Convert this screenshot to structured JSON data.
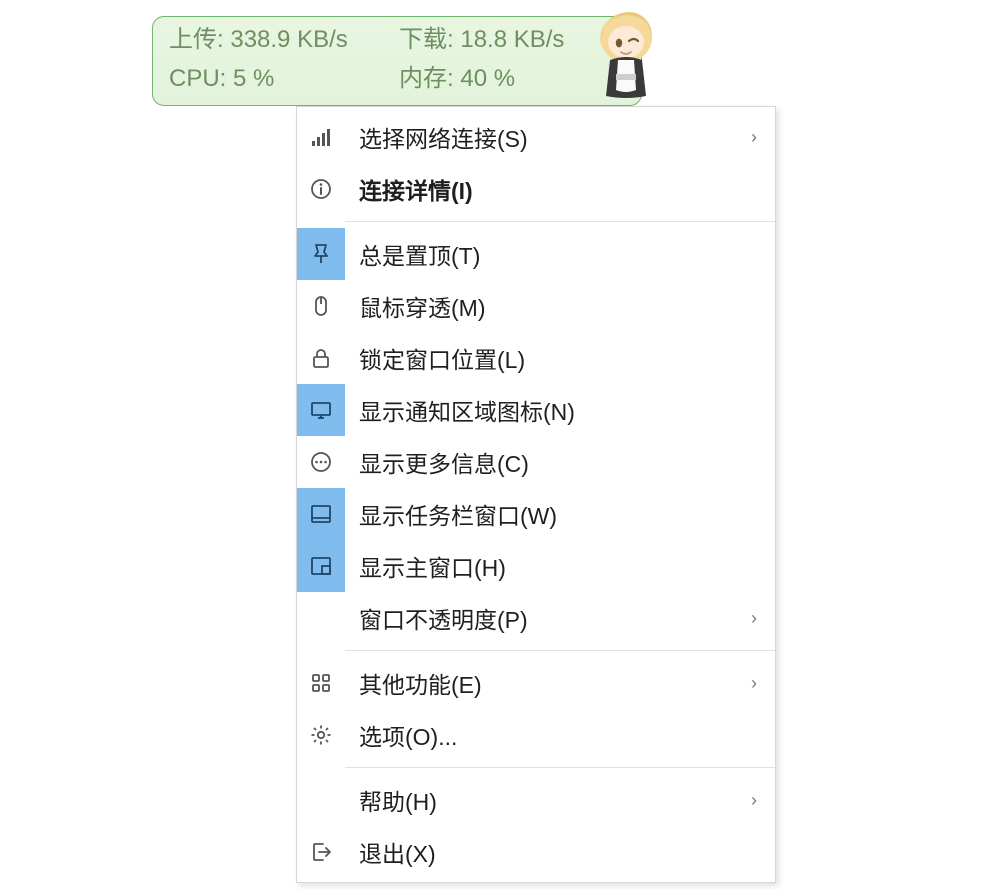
{
  "widget": {
    "upload_label": "上传:",
    "upload_value": "338.9 KB/s",
    "download_label": "下载:",
    "download_value": "18.8 KB/s",
    "cpu_label": "CPU:",
    "cpu_value": "5 %",
    "mem_label": "内存:",
    "mem_value": "40 %",
    "border_color": "#71b56e",
    "bg_color": "#e6f4de",
    "text_color": "#6e8f62"
  },
  "menu": {
    "items": [
      {
        "id": "select-network",
        "icon": "signal-icon",
        "label": "选择网络连接(S)",
        "submenu": true,
        "selected": false,
        "bold": false
      },
      {
        "id": "conn-details",
        "icon": "info-icon",
        "label": "连接详情(I)",
        "submenu": false,
        "selected": false,
        "bold": true
      },
      {
        "sep": true
      },
      {
        "id": "always-top",
        "icon": "pin-icon",
        "label": "总是置顶(T)",
        "submenu": false,
        "selected": true,
        "bold": false
      },
      {
        "id": "mouse-through",
        "icon": "mouse-icon",
        "label": "鼠标穿透(M)",
        "submenu": false,
        "selected": false,
        "bold": false
      },
      {
        "id": "lock-pos",
        "icon": "lock-icon",
        "label": "锁定窗口位置(L)",
        "submenu": false,
        "selected": false,
        "bold": false
      },
      {
        "id": "tray-icon",
        "icon": "tray-icon",
        "label": "显示通知区域图标(N)",
        "submenu": false,
        "selected": true,
        "bold": false
      },
      {
        "id": "show-more",
        "icon": "ellipsis-icon",
        "label": "显示更多信息(C)",
        "submenu": false,
        "selected": false,
        "bold": false
      },
      {
        "id": "taskbar-window",
        "icon": "taskbar-icon",
        "label": "显示任务栏窗口(W)",
        "submenu": false,
        "selected": true,
        "bold": false
      },
      {
        "id": "main-window",
        "icon": "mainwin-icon",
        "label": "显示主窗口(H)",
        "submenu": false,
        "selected": true,
        "bold": false
      },
      {
        "id": "opacity",
        "icon": "",
        "label": "窗口不透明度(P)",
        "submenu": true,
        "selected": false,
        "bold": false
      },
      {
        "sep": true
      },
      {
        "id": "other-func",
        "icon": "grid-icon",
        "label": "其他功能(E)",
        "submenu": true,
        "selected": false,
        "bold": false
      },
      {
        "id": "options",
        "icon": "gear-icon",
        "label": "选项(O)...",
        "submenu": false,
        "selected": false,
        "bold": false
      },
      {
        "sep": true
      },
      {
        "id": "help",
        "icon": "",
        "label": "帮助(H)",
        "submenu": true,
        "selected": false,
        "bold": false
      },
      {
        "id": "exit",
        "icon": "exit-icon",
        "label": "退出(X)",
        "submenu": false,
        "selected": false,
        "bold": false
      }
    ],
    "arrow_glyph": "›"
  }
}
